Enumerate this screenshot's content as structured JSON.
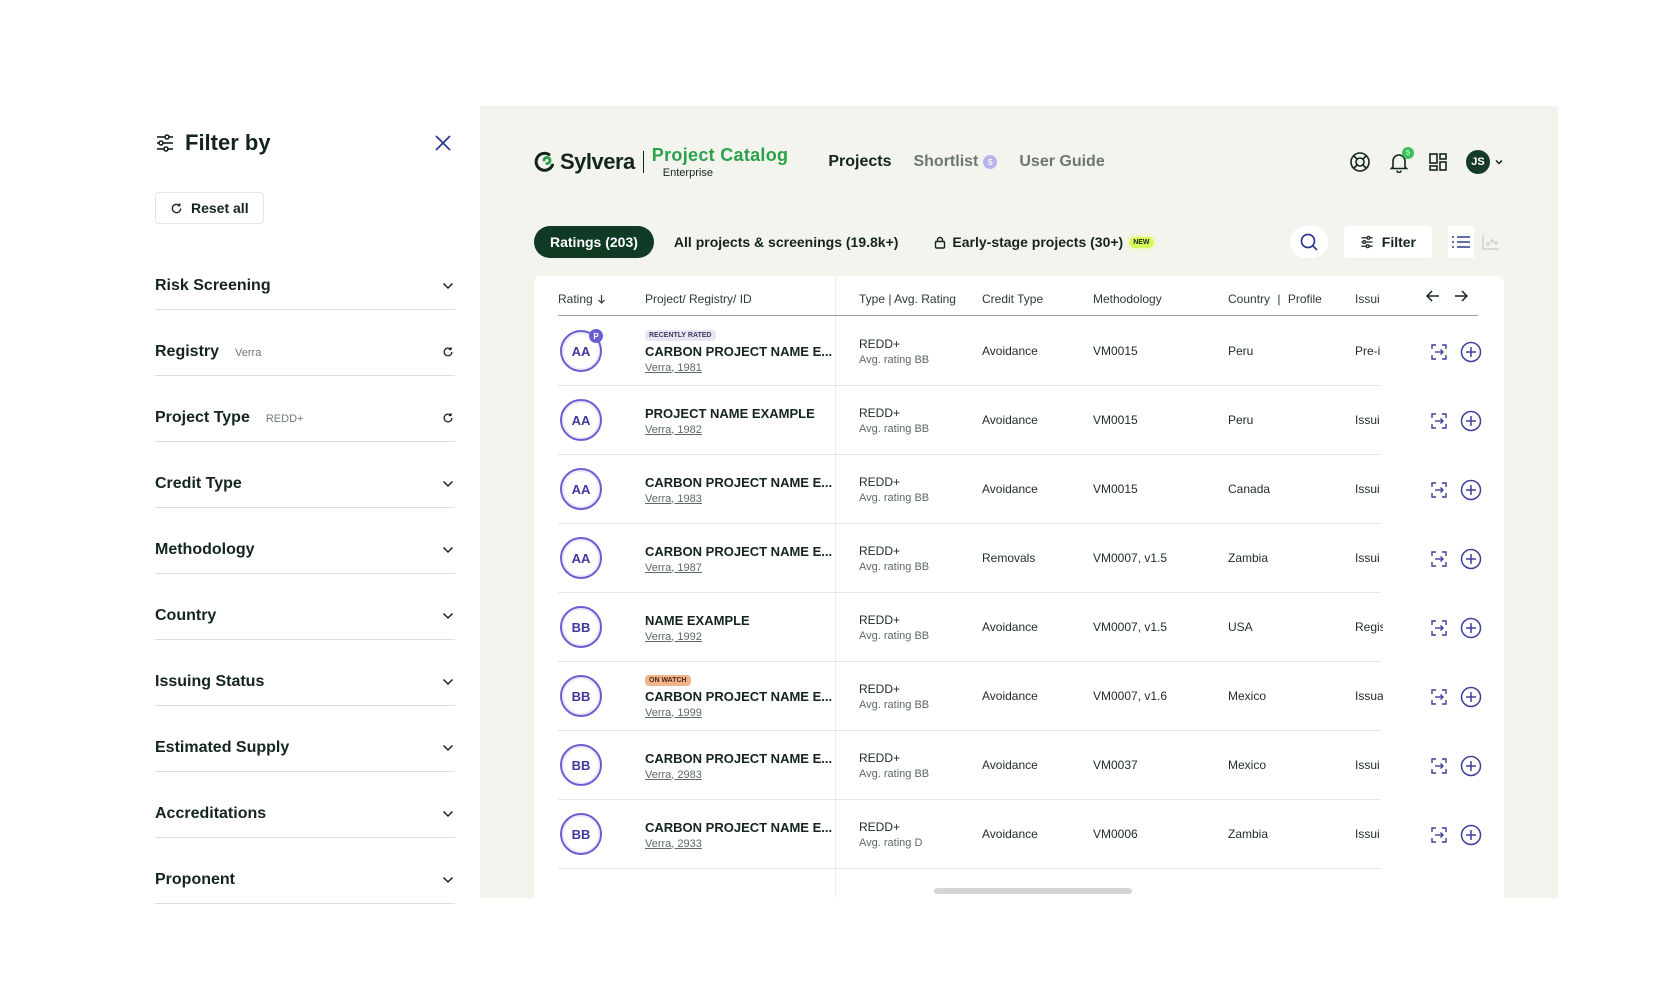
{
  "filter_panel": {
    "title": "Filter by",
    "reset_label": "Reset all",
    "sections": [
      {
        "label": "Risk Screening",
        "value": "",
        "control": "chevron"
      },
      {
        "label": "Registry",
        "value": "Verra",
        "control": "reset"
      },
      {
        "label": "Project Type",
        "value": "REDD+",
        "control": "reset"
      },
      {
        "label": "Credit Type",
        "value": "",
        "control": "chevron"
      },
      {
        "label": "Methodology",
        "value": "",
        "control": "chevron"
      },
      {
        "label": "Country",
        "value": "",
        "control": "chevron"
      },
      {
        "label": "Issuing Status",
        "value": "",
        "control": "chevron"
      },
      {
        "label": "Estimated Supply",
        "value": "",
        "control": "chevron"
      },
      {
        "label": "Accreditations",
        "value": "",
        "control": "chevron"
      },
      {
        "label": "Proponent",
        "value": "",
        "control": "chevron"
      }
    ]
  },
  "header": {
    "brand_name": "Sylvera",
    "product_name": "Project Catalog",
    "edition": "Enterprise",
    "nav": [
      {
        "label": "Projects",
        "active": true,
        "count": ""
      },
      {
        "label": "Shortlist",
        "active": false,
        "count": "5"
      },
      {
        "label": "User Guide",
        "active": false,
        "count": ""
      }
    ],
    "notification_count": "5",
    "user_initials": "JS"
  },
  "toolbar": {
    "tabs": [
      {
        "label": "Ratings (203)",
        "active": true
      },
      {
        "label": "All projects & screenings (19.8k+)",
        "active": false
      },
      {
        "label": "Early-stage projects (30+)",
        "active": false,
        "badge": "NEW"
      }
    ],
    "filter_label": "Filter"
  },
  "table": {
    "columns": {
      "rating": "Rating",
      "project": "Project/ Registry/ ID",
      "type": "Type | Avg. Rating",
      "credit": "Credit Type",
      "methodology": "Methodology",
      "country": "Country",
      "profile": "Profile",
      "issuing": "Issui"
    },
    "rows": [
      {
        "rating": "AA",
        "pbadge": "P",
        "badge": "RECENTLY RATED",
        "badge_kind": "recent",
        "name": "CARBON PROJECT NAME E...",
        "registry": "Verra, 1981",
        "type": "REDD+",
        "avg": "Avg. rating BB",
        "credit": "Avoidance",
        "methodology": "VM0015",
        "country": "Peru",
        "issuing": "Pre-i"
      },
      {
        "rating": "AA",
        "pbadge": "",
        "badge": "",
        "badge_kind": "",
        "name": "PROJECT NAME EXAMPLE",
        "registry": "Verra, 1982",
        "type": "REDD+",
        "avg": "Avg. rating BB",
        "credit": "Avoidance",
        "methodology": "VM0015",
        "country": "Peru",
        "issuing": "Issui"
      },
      {
        "rating": "AA",
        "pbadge": "",
        "badge": "",
        "badge_kind": "",
        "name": "CARBON PROJECT NAME E...",
        "registry": "Verra, 1983",
        "type": "REDD+",
        "avg": "Avg. rating BB",
        "credit": "Avoidance",
        "methodology": "VM0015",
        "country": "Canada",
        "issuing": "Issui"
      },
      {
        "rating": "AA",
        "pbadge": "",
        "badge": "",
        "badge_kind": "",
        "name": "CARBON PROJECT NAME E...",
        "registry": "Verra, 1987",
        "type": "REDD+",
        "avg": "Avg. rating BB",
        "credit": "Removals",
        "methodology": "VM0007, v1.5",
        "country": "Zambia",
        "issuing": "Issui"
      },
      {
        "rating": "BB",
        "pbadge": "",
        "badge": "",
        "badge_kind": "",
        "name": "NAME EXAMPLE",
        "registry": "Verra, 1992",
        "type": "REDD+",
        "avg": "Avg. rating BB",
        "credit": "Avoidance",
        "methodology": "VM0007, v1.5",
        "country": "USA",
        "issuing": "Regis"
      },
      {
        "rating": "BB",
        "pbadge": "",
        "badge": "ON WATCH",
        "badge_kind": "watch",
        "name": "CARBON PROJECT NAME E...",
        "registry": "Verra, 1999",
        "type": "REDD+",
        "avg": "Avg. rating BB",
        "credit": "Avoidance",
        "methodology": "VM0007, v1.6",
        "country": "Mexico",
        "issuing": "Issua"
      },
      {
        "rating": "BB",
        "pbadge": "",
        "badge": "",
        "badge_kind": "",
        "name": "CARBON PROJECT NAME E...",
        "registry": "Verra, 2983",
        "type": "REDD+",
        "avg": "Avg. rating BB",
        "credit": "Avoidance",
        "methodology": "VM0037",
        "country": "Mexico",
        "issuing": "Issui"
      },
      {
        "rating": "BB",
        "pbadge": "",
        "badge": "",
        "badge_kind": "",
        "name": "CARBON PROJECT NAME E...",
        "registry": "Verra, 2933",
        "type": "REDD+",
        "avg": "Avg. rating D",
        "credit": "Avoidance",
        "methodology": "VM0006",
        "country": "Zambia",
        "issuing": "Issui"
      }
    ]
  },
  "colors": {
    "brand_green": "#2aa14b",
    "dark_green": "#0f3b24",
    "rating_purple": "#6a5fd1",
    "new_badge": "#d9f95a",
    "watch_badge": "#f2b48b"
  },
  "icons": {
    "filter": "sliders-icon",
    "close": "close-icon",
    "reset": "refresh-icon",
    "chevron": "chevron-down-icon",
    "help": "lifebuoy-icon",
    "bell": "bell-icon",
    "apps": "grid-icon",
    "search": "search-icon",
    "lock": "lock-icon",
    "list": "list-view-icon",
    "chart": "chart-view-icon",
    "compare": "compare-icon",
    "add": "add-circle-icon"
  }
}
